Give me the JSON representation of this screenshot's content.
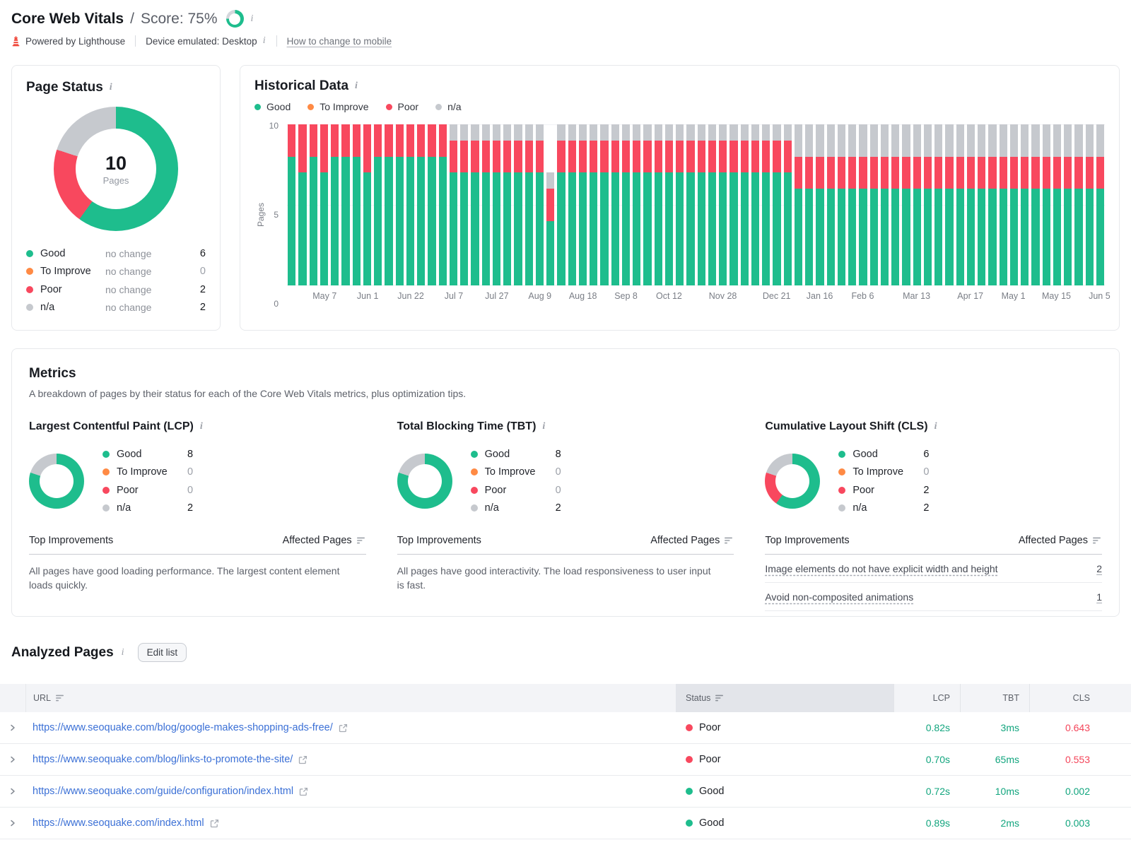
{
  "colors": {
    "good": "#1ebd8d",
    "to_improve": "#ff8a44",
    "poor": "#f8485e",
    "na": "#c6c9ce",
    "good_text": "#12a57e",
    "poor_text": "#f4455a",
    "link": "#3b70d6",
    "ring_rest": "#d4d7dc"
  },
  "header": {
    "title": "Core Web Vitals",
    "score_prefix": "/",
    "score_label": "Score: 75%",
    "score_percent": 75,
    "powered_by": "Powered by Lighthouse",
    "device_label": "Device emulated: Desktop",
    "mobile_link": "How to change to mobile"
  },
  "page_status": {
    "title": "Page Status",
    "total_value": "10",
    "total_label": "Pages",
    "donut": {
      "values": [
        6,
        0,
        2,
        2
      ],
      "color_keys": [
        "good",
        "to_improve",
        "poor",
        "na"
      ]
    },
    "legend": [
      {
        "label": "Good",
        "change": "no change",
        "value": 6,
        "color_key": "good"
      },
      {
        "label": "To Improve",
        "change": "no change",
        "value": 0,
        "color_key": "to_improve"
      },
      {
        "label": "Poor",
        "change": "no change",
        "value": 2,
        "color_key": "poor"
      },
      {
        "label": "n/a",
        "change": "no change",
        "value": 2,
        "color_key": "na"
      }
    ]
  },
  "historical": {
    "title": "Historical Data",
    "legend": [
      {
        "label": "Good",
        "color_key": "good"
      },
      {
        "label": "To Improve",
        "color_key": "to_improve"
      },
      {
        "label": "Poor",
        "color_key": "poor"
      },
      {
        "label": "n/a",
        "color_key": "na"
      }
    ],
    "ylabel": "Pages",
    "yticks": [
      "10",
      "5",
      "0"
    ]
  },
  "chart_data": {
    "type": "bar",
    "stacked": true,
    "title": "Historical Data",
    "xlabel": "",
    "ylabel": "Pages",
    "ylim": [
      0,
      10
    ],
    "grid": true,
    "legend_position": "top",
    "series_names": [
      "Good",
      "To Improve",
      "Poor",
      "n/a"
    ],
    "bar_value_order": [
      "Good",
      "Poor",
      "n/a"
    ],
    "note": "Each bar is [good, poor, na] page counts per snapshot; To Improve is 0 throughout.",
    "bars": [
      [
        8,
        2,
        0
      ],
      [
        7,
        3,
        0
      ],
      [
        8,
        2,
        0
      ],
      [
        7,
        3,
        0
      ],
      [
        8,
        2,
        0
      ],
      [
        8,
        2,
        0
      ],
      [
        8,
        2,
        0
      ],
      [
        7,
        3,
        0
      ],
      [
        8,
        2,
        0
      ],
      [
        8,
        2,
        0
      ],
      [
        8,
        2,
        0
      ],
      [
        8,
        2,
        0
      ],
      [
        8,
        2,
        0
      ],
      [
        8,
        2,
        0
      ],
      [
        8,
        2,
        0
      ],
      [
        7,
        2,
        1
      ],
      [
        7,
        2,
        1
      ],
      [
        7,
        2,
        1
      ],
      [
        7,
        2,
        1
      ],
      [
        7,
        2,
        1
      ],
      [
        7,
        2,
        1
      ],
      [
        7,
        2,
        1
      ],
      [
        7,
        2,
        1
      ],
      [
        7,
        2,
        1
      ],
      [
        4,
        2,
        1
      ],
      [
        7,
        2,
        1
      ],
      [
        7,
        2,
        1
      ],
      [
        7,
        2,
        1
      ],
      [
        7,
        2,
        1
      ],
      [
        7,
        2,
        1
      ],
      [
        7,
        2,
        1
      ],
      [
        7,
        2,
        1
      ],
      [
        7,
        2,
        1
      ],
      [
        7,
        2,
        1
      ],
      [
        7,
        2,
        1
      ],
      [
        7,
        2,
        1
      ],
      [
        7,
        2,
        1
      ],
      [
        7,
        2,
        1
      ],
      [
        7,
        2,
        1
      ],
      [
        7,
        2,
        1
      ],
      [
        7,
        2,
        1
      ],
      [
        7,
        2,
        1
      ],
      [
        7,
        2,
        1
      ],
      [
        7,
        2,
        1
      ],
      [
        7,
        2,
        1
      ],
      [
        7,
        2,
        1
      ],
      [
        7,
        2,
        1
      ],
      [
        6,
        2,
        2
      ],
      [
        6,
        2,
        2
      ],
      [
        6,
        2,
        2
      ],
      [
        6,
        2,
        2
      ],
      [
        6,
        2,
        2
      ],
      [
        6,
        2,
        2
      ],
      [
        6,
        2,
        2
      ],
      [
        6,
        2,
        2
      ],
      [
        6,
        2,
        2
      ],
      [
        6,
        2,
        2
      ],
      [
        6,
        2,
        2
      ],
      [
        6,
        2,
        2
      ],
      [
        6,
        2,
        2
      ],
      [
        6,
        2,
        2
      ],
      [
        6,
        2,
        2
      ],
      [
        6,
        2,
        2
      ],
      [
        6,
        2,
        2
      ],
      [
        6,
        2,
        2
      ],
      [
        6,
        2,
        2
      ],
      [
        6,
        2,
        2
      ],
      [
        6,
        2,
        2
      ],
      [
        6,
        2,
        2
      ],
      [
        6,
        2,
        2
      ],
      [
        6,
        2,
        2
      ],
      [
        6,
        2,
        2
      ],
      [
        6,
        2,
        2
      ],
      [
        6,
        2,
        2
      ],
      [
        6,
        2,
        2
      ],
      [
        6,
        2,
        2
      ]
    ],
    "x_ticks": [
      {
        "label": "May 7",
        "bar": 4
      },
      {
        "label": "Jun 1",
        "bar": 8
      },
      {
        "label": "Jun 22",
        "bar": 12
      },
      {
        "label": "Jul 7",
        "bar": 16
      },
      {
        "label": "Jul 27",
        "bar": 20
      },
      {
        "label": "Aug 9",
        "bar": 24
      },
      {
        "label": "Aug 18",
        "bar": 28
      },
      {
        "label": "Sep 8",
        "bar": 32
      },
      {
        "label": "Oct 12",
        "bar": 36
      },
      {
        "label": "Nov 28",
        "bar": 41
      },
      {
        "label": "Dec 21",
        "bar": 46
      },
      {
        "label": "Jan 16",
        "bar": 50
      },
      {
        "label": "Feb 6",
        "bar": 54
      },
      {
        "label": "Mar 13",
        "bar": 59
      },
      {
        "label": "Apr 17",
        "bar": 64
      },
      {
        "label": "May 1",
        "bar": 68
      },
      {
        "label": "May 15",
        "bar": 72
      },
      {
        "label": "Jun 5",
        "bar": 76
      }
    ]
  },
  "metrics": {
    "title": "Metrics",
    "description": "A breakdown of pages by their status for each of the Core Web Vitals metrics, plus optimization tips.",
    "improvements_header": "Top Improvements",
    "affected_header": "Affected Pages",
    "cards": [
      {
        "title": "Largest Contentful Paint (LCP)",
        "donut": {
          "values": [
            8,
            0,
            0,
            2
          ],
          "color_keys": [
            "good",
            "to_improve",
            "poor",
            "na"
          ]
        },
        "legend": [
          {
            "label": "Good",
            "value": 8,
            "color_key": "good"
          },
          {
            "label": "To Improve",
            "value": 0,
            "color_key": "to_improve"
          },
          {
            "label": "Poor",
            "value": 0,
            "color_key": "poor"
          },
          {
            "label": "n/a",
            "value": 2,
            "color_key": "na"
          }
        ],
        "note": "All pages have good loading performance. The largest content element loads quickly.",
        "improvements": []
      },
      {
        "title": "Total Blocking Time (TBT)",
        "donut": {
          "values": [
            8,
            0,
            0,
            2
          ],
          "color_keys": [
            "good",
            "to_improve",
            "poor",
            "na"
          ]
        },
        "legend": [
          {
            "label": "Good",
            "value": 8,
            "color_key": "good"
          },
          {
            "label": "To Improve",
            "value": 0,
            "color_key": "to_improve"
          },
          {
            "label": "Poor",
            "value": 0,
            "color_key": "poor"
          },
          {
            "label": "n/a",
            "value": 2,
            "color_key": "na"
          }
        ],
        "note": "All pages have good interactivity. The load responsiveness to user input is fast.",
        "improvements": []
      },
      {
        "title": "Cumulative Layout Shift (CLS)",
        "donut": {
          "values": [
            6,
            0,
            2,
            2
          ],
          "color_keys": [
            "good",
            "to_improve",
            "poor",
            "na"
          ]
        },
        "legend": [
          {
            "label": "Good",
            "value": 6,
            "color_key": "good"
          },
          {
            "label": "To Improve",
            "value": 0,
            "color_key": "to_improve"
          },
          {
            "label": "Poor",
            "value": 2,
            "color_key": "poor"
          },
          {
            "label": "n/a",
            "value": 2,
            "color_key": "na"
          }
        ],
        "note": "",
        "improvements": [
          {
            "text": "Image elements do not have explicit width and height",
            "value": "2"
          },
          {
            "text": "Avoid non-composited animations",
            "value": "1"
          }
        ]
      }
    ]
  },
  "analyzed": {
    "title": "Analyzed Pages",
    "edit_button": "Edit list",
    "columns": {
      "url": "URL",
      "status": "Status",
      "lcp": "LCP",
      "tbt": "TBT",
      "cls": "CLS"
    },
    "rows": [
      {
        "url": "https://www.seoquake.com/blog/google-makes-shopping-ads-free/",
        "status": "Poor",
        "status_key": "poor",
        "lcp": "0.82s",
        "lcp_key": "good",
        "tbt": "3ms",
        "tbt_key": "good",
        "cls": "0.643",
        "cls_key": "poor"
      },
      {
        "url": "https://www.seoquake.com/blog/links-to-promote-the-site/",
        "status": "Poor",
        "status_key": "poor",
        "lcp": "0.70s",
        "lcp_key": "good",
        "tbt": "65ms",
        "tbt_key": "good",
        "cls": "0.553",
        "cls_key": "poor"
      },
      {
        "url": "https://www.seoquake.com/guide/configuration/index.html",
        "status": "Good",
        "status_key": "good",
        "lcp": "0.72s",
        "lcp_key": "good",
        "tbt": "10ms",
        "tbt_key": "good",
        "cls": "0.002",
        "cls_key": "good"
      },
      {
        "url": "https://www.seoquake.com/index.html",
        "status": "Good",
        "status_key": "good",
        "lcp": "0.89s",
        "lcp_key": "good",
        "tbt": "2ms",
        "tbt_key": "good",
        "cls": "0.003",
        "cls_key": "good"
      }
    ]
  }
}
